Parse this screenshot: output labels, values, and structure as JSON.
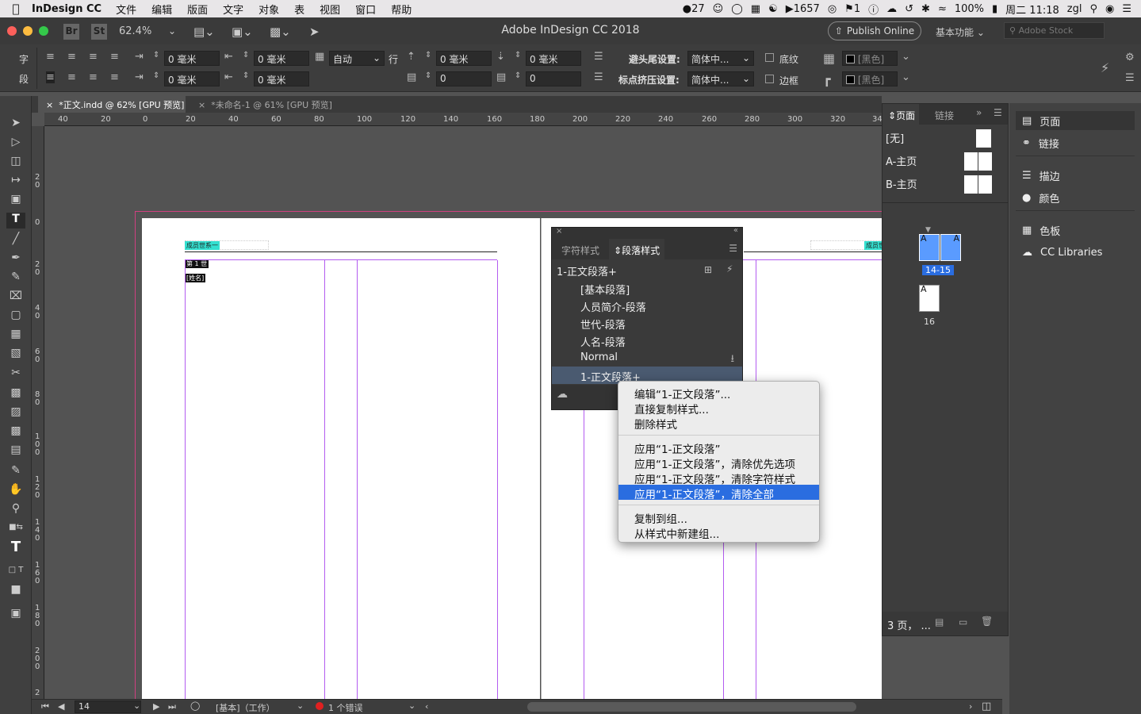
{
  "menubar": {
    "app_name": "InDesign CC",
    "items": [
      "文件",
      "编辑",
      "版面",
      "文字",
      "对象",
      "表",
      "视图",
      "窗口",
      "帮助"
    ],
    "status": {
      "badge_count": "27",
      "num_1657": "1657",
      "notif_count": "1",
      "battery": "100%",
      "clock": "周二 11:18",
      "user": "zgl"
    }
  },
  "titlebar": {
    "title": "Adobe InDesign CC 2018",
    "br": "Br",
    "st": "St",
    "zoom": "62.4%",
    "publish": "Publish Online",
    "workspace": "基本功能",
    "stock_placeholder": "Adobe Stock"
  },
  "control": {
    "char_label": "字",
    "para_label": "段",
    "indent_left": "0 毫米",
    "indent_right_first": "0 毫米",
    "indent_first": "0 毫米",
    "indent_last": "0 毫米",
    "auto": "自动",
    "row": "行",
    "space_before": "0 毫米",
    "space_after": "0 毫米",
    "drop_lines": "0",
    "drop_chars": "0",
    "kinsoku_label": "避头尾设置:",
    "kinsoku_value": "简体中...",
    "mojikumi_label": "标点挤压设置:",
    "mojikumi_value": "简体中...",
    "underline": "底纹",
    "border": "边框",
    "color1": "[黑色]",
    "color2": "[黑色]"
  },
  "tabs": [
    {
      "label": "*正文.indd @ 62% [GPU 预览]"
    },
    {
      "label": "*未命名-1 @ 61% [GPU 预览]"
    }
  ],
  "ruler": {
    "h_ticks": [
      "40",
      "20",
      "0",
      "20",
      "40",
      "60",
      "80",
      "100",
      "120",
      "140",
      "160",
      "180",
      "200",
      "220",
      "240",
      "260",
      "280",
      "300",
      "320",
      "34"
    ],
    "v_ticks": [
      "2\n0",
      "0",
      "2\n0",
      "4\n0",
      "6\n0",
      "8\n0",
      "1\n0\n0",
      "1\n2\n0",
      "1\n4\n0",
      "1\n6\n0",
      "1\n8\n0",
      "2\n0\n0",
      "2"
    ]
  },
  "page_text": {
    "header_left": "成员世系一",
    "gen_label": "第 1 世",
    "name_label": "[姓名]",
    "header_right": "成员世"
  },
  "styles_panel": {
    "tab_char": "字符样式",
    "tab_para": "段落样式",
    "current": "1-正文段落+",
    "items": [
      "[基本段落]",
      "人员简介-段落",
      "世代-段落",
      "人名-段落",
      "Normal",
      "1-正文段落+"
    ]
  },
  "context_menu": {
    "group1": [
      "编辑“1-正文段落”...",
      "直接复制样式...",
      "删除样式"
    ],
    "group2": [
      "应用“1-正文段落”",
      "应用“1-正文段落”，清除优先选项",
      "应用“1-正文段落”，清除字符样式",
      "应用“1-正文段落”，清除全部"
    ],
    "group3": [
      "复制到组...",
      "从样式中新建组..."
    ],
    "highlighted_index": 3
  },
  "pages_panel": {
    "tab_pages": "页面",
    "tab_links": "链接",
    "none": "[无]",
    "master_a": "A-主页",
    "master_b": "B-主页",
    "spread1_label": "14-15",
    "spread2_label": "16",
    "master_letter": "A",
    "footer": "3 页， ..."
  },
  "dock": {
    "items": [
      "页面",
      "链接",
      "描边",
      "颜色",
      "色板",
      "CC Libraries"
    ]
  },
  "status": {
    "page": "14",
    "mode": "[基本]（工作）",
    "errors": "1 个错误"
  },
  "colors": {
    "accent": "#2a6de0",
    "margin_guide": "#b35cf0",
    "header_tag": "#33e0d0"
  }
}
